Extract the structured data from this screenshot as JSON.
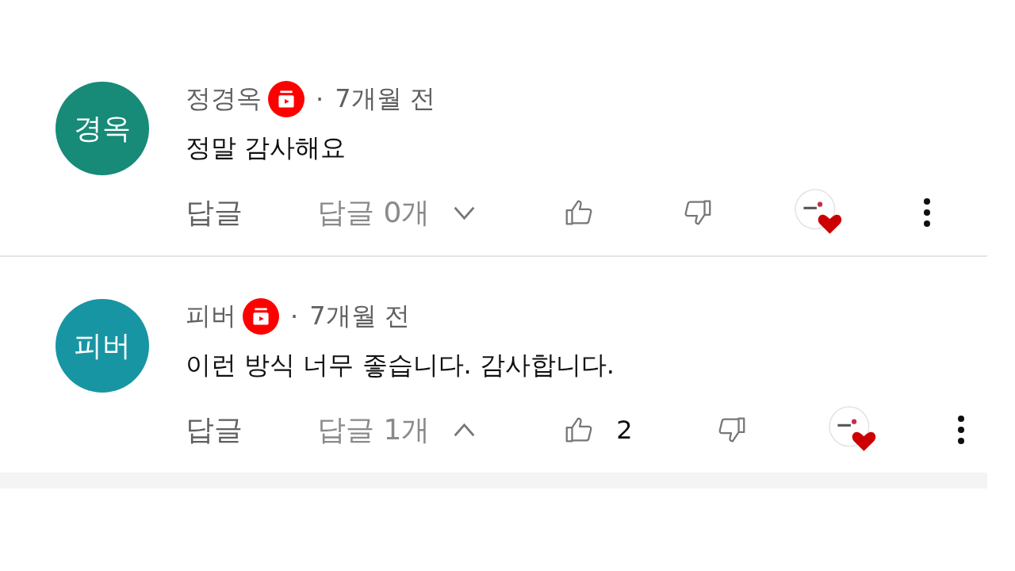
{
  "comments": [
    {
      "avatar_text": "경옥",
      "color": "#178a78",
      "author": "정경옥",
      "separator": "·",
      "time": "7개월 전",
      "text": "정말 감사해요",
      "reply_button": "답글",
      "replies_label": "답글 0개",
      "expanded": false
    },
    {
      "avatar_text": "피버",
      "color": "#1895a3",
      "author": "피버",
      "separator": "·",
      "time": "7개월 전",
      "text": "이런 방식 너무 좋습니다. 감사합니다.",
      "reply_button": "답글",
      "replies_label": "답글 1개",
      "expanded": true,
      "likes": "2"
    }
  ]
}
